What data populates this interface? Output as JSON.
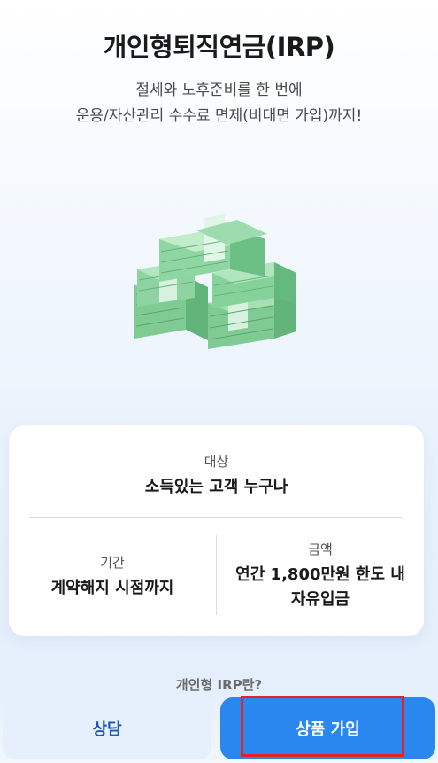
{
  "header": {
    "title": "개인형퇴직연금(IRP)",
    "subtitle_line1": "절세와 노후준비를 한 번에",
    "subtitle_line2": "운용/자산관리 수수료 면제(비대면 가입)까지!"
  },
  "illustration": {
    "icon": "money-stack-icon",
    "colors": {
      "bill": "#86d29a",
      "band": "#d8f2df",
      "edge": "#5fb87a"
    }
  },
  "info": {
    "target_label": "대상",
    "target_value": "소득있는 고객 누구나",
    "period_label": "기간",
    "period_value": "계약해지 시점까지",
    "amount_label": "금액",
    "amount_value_line1": "연간 1,800만원 한도 내",
    "amount_value_line2": "자유입금"
  },
  "link": {
    "label": "개인형 IRP란?"
  },
  "buttons": {
    "consult_label": "상담",
    "join_label": "상품 가입"
  },
  "colors": {
    "primary": "#2b87f0",
    "secondary_bg": "#e6f0fc",
    "secondary_text": "#1a57b8",
    "highlight": "#e52222"
  }
}
